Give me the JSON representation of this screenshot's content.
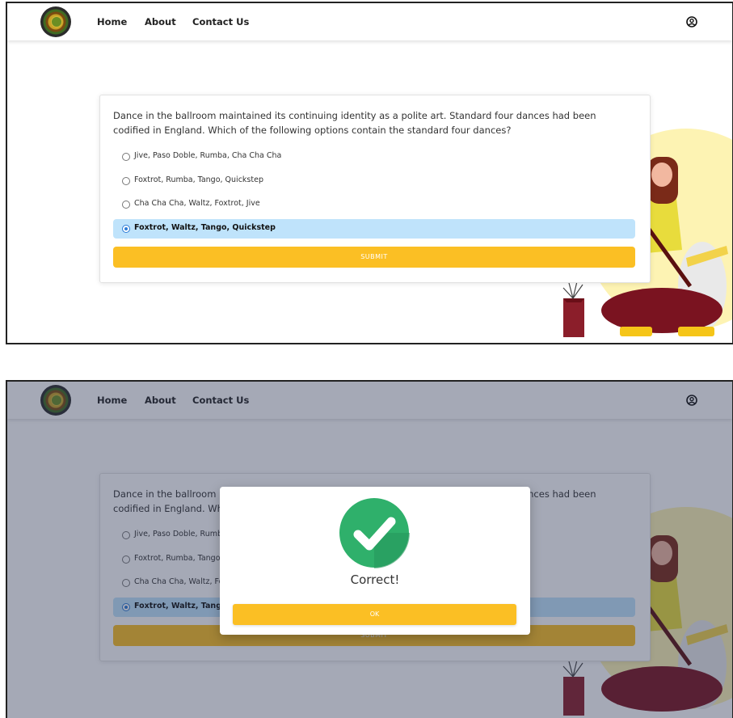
{
  "nav": {
    "links": [
      "Home",
      "About",
      "Contact Us"
    ],
    "icons": [
      "logo-icon",
      "user-circle-icon"
    ]
  },
  "quiz": {
    "question": "Dance in the ballroom maintained its continuing identity as a polite art. Standard four dances had been codified in England. Which of the following options contain the standard four dances?",
    "options": [
      "Jive, Paso Doble, Rumba, Cha Cha Cha",
      "Foxtrot, Rumba, Tango, Quickstep",
      "Cha Cha Cha, Waltz, Foxtrot, Jive",
      "Foxtrot, Waltz, Tango, Quickstep"
    ],
    "selected_option": "Foxtrot, Waltz, Tango, Quickstep",
    "submit_label": "SUBMIT"
  },
  "modal": {
    "message": "Correct!",
    "ok_label": "OK",
    "icon": "check-circle-icon"
  },
  "colors": {
    "accent": "#fbbf24",
    "selected_bg": "#bfe3fb",
    "success": "#2fb06b"
  }
}
